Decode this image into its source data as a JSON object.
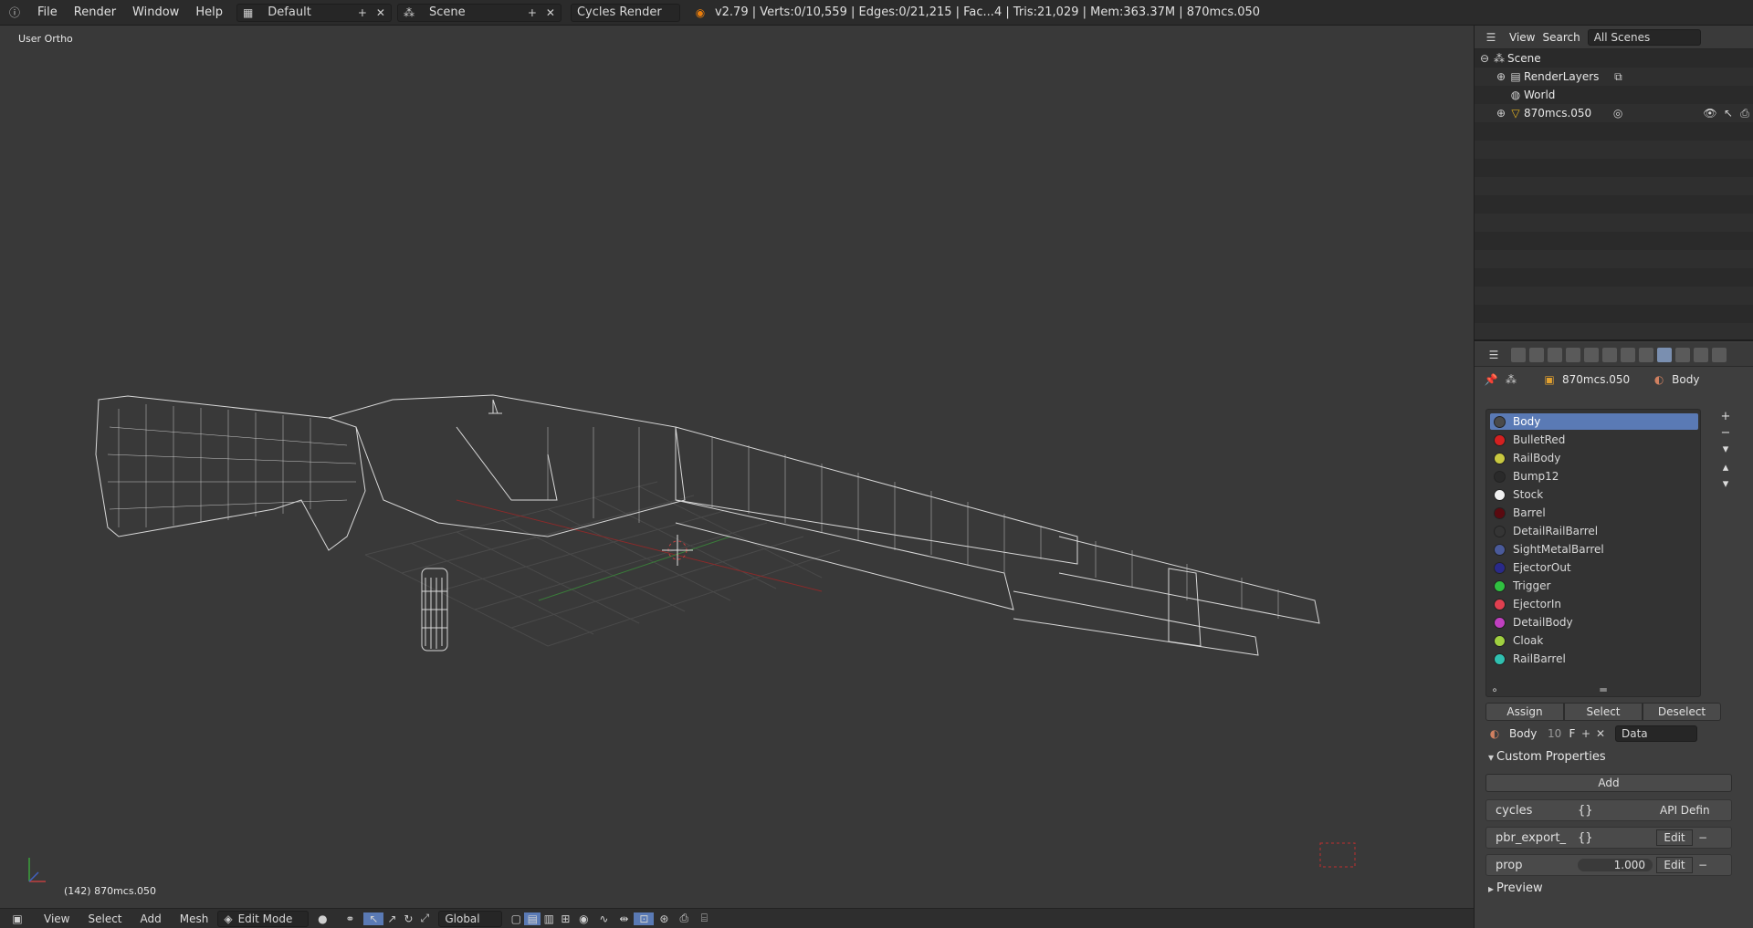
{
  "topbar": {
    "menus": [
      "File",
      "Render",
      "Window",
      "Help"
    ],
    "layout": "Default",
    "scene": "Scene",
    "engine": "Cycles Render",
    "stats": "v2.79 | Verts:0/10,559 | Edges:0/21,215 | Fac...4 | Tris:21,029 | Mem:363.37M | 870mcs.050"
  },
  "viewport": {
    "view_label": "User Ortho",
    "object_label": "(142) 870mcs.050"
  },
  "bottombar": {
    "menus": [
      "View",
      "Select",
      "Add",
      "Mesh"
    ],
    "mode": "Edit Mode",
    "orientation": "Global"
  },
  "outliner": {
    "menus": [
      "View",
      "Search"
    ],
    "filter": "All Scenes",
    "items": [
      {
        "label": "Scene",
        "icon": "scene-icon"
      },
      {
        "label": "RenderLayers",
        "icon": "render-layers-icon"
      },
      {
        "label": "World",
        "icon": "world-icon"
      },
      {
        "label": "870mcs.050",
        "icon": "mesh-object-icon"
      }
    ]
  },
  "properties": {
    "breadcrumb_object": "870mcs.050",
    "breadcrumb_material": "Body",
    "materials": [
      {
        "name": "Body",
        "color": "#4a4a4a",
        "selected": true
      },
      {
        "name": "BulletRed",
        "color": "#d42020"
      },
      {
        "name": "RailBody",
        "color": "#c8c840"
      },
      {
        "name": "Bump12",
        "color": "#2a2a2a"
      },
      {
        "name": "Stock",
        "color": "#f0f0f0"
      },
      {
        "name": "Barrel",
        "color": "#5a0a10"
      },
      {
        "name": "DetailRailBarrel",
        "color": "#353535"
      },
      {
        "name": "SightMetalBarrel",
        "color": "#4a5a9a"
      },
      {
        "name": "EjectorOut",
        "color": "#2a2a8a"
      },
      {
        "name": "Trigger",
        "color": "#30c040"
      },
      {
        "name": "EjectorIn",
        "color": "#e04050"
      },
      {
        "name": "DetailBody",
        "color": "#c040c0"
      },
      {
        "name": "Cloak",
        "color": "#a0d040"
      },
      {
        "name": "RailBarrel",
        "color": "#30c0b0"
      }
    ],
    "buttons": {
      "assign": "Assign",
      "select": "Select",
      "deselect": "Deselect"
    },
    "slot": {
      "name": "Body",
      "users": "10",
      "fake": "F",
      "link": "Data"
    },
    "custom_properties": {
      "title": "Custom Properties",
      "add": "Add",
      "rows": [
        {
          "key": "cycles",
          "value": "{}",
          "action": "API Defin"
        },
        {
          "key": "pbr_export_",
          "value": "{}",
          "action": "Edit"
        },
        {
          "key": "prop",
          "value": "1.000",
          "action": "Edit"
        }
      ]
    },
    "preview": "Preview"
  }
}
